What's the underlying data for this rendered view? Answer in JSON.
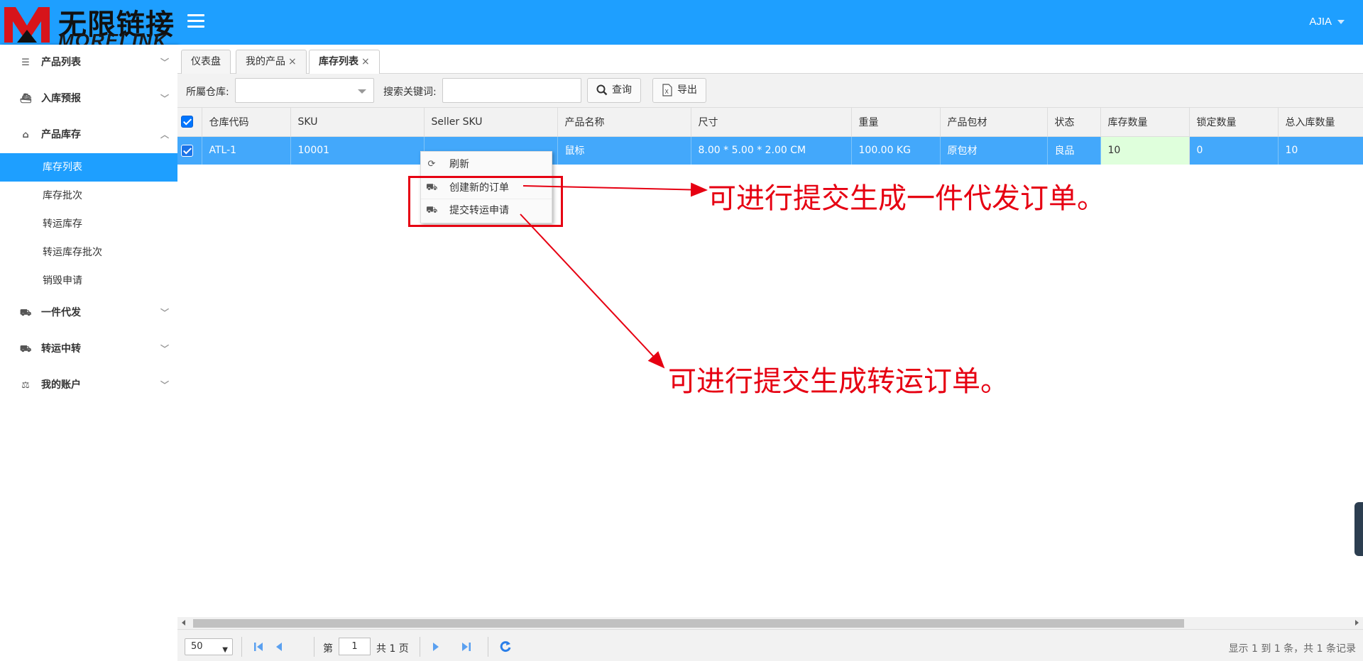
{
  "brand": {
    "cn": "无限链接",
    "en": "MORELINK"
  },
  "header": {
    "user": "AJIA"
  },
  "sidebar": {
    "groups": [
      {
        "label": "产品列表",
        "icon": "list-icon",
        "chevron": "﹀"
      },
      {
        "label": "入库预报",
        "icon": "ship-icon",
        "chevron": "﹀"
      },
      {
        "label": "产品库存",
        "icon": "inbox-icon",
        "chevron": "︿"
      },
      {
        "label": "一件代发",
        "icon": "truck-icon",
        "chevron": "﹀"
      },
      {
        "label": "转运中转",
        "icon": "truck-icon",
        "chevron": "﹀"
      },
      {
        "label": "我的账户",
        "icon": "scale-icon",
        "chevron": "﹀"
      }
    ],
    "sub_items": [
      "库存列表",
      "库存批次",
      "转运库存",
      "转运库存批次",
      "销毁申请"
    ]
  },
  "tabs": [
    {
      "label": "仪表盘"
    },
    {
      "label": "我的产品",
      "close": "×"
    },
    {
      "label": "库存列表",
      "close": "×"
    }
  ],
  "toolbar": {
    "warehouse_label": "所屬仓库:",
    "warehouse_value": "",
    "keyword_label": "搜索关键词:",
    "keyword_value": "",
    "query_button": "查询",
    "export_button": "导出"
  },
  "table": {
    "columns": [
      "仓库代码",
      "SKU",
      "Seller SKU",
      "产品名称",
      "尺寸",
      "重量",
      "产品包材",
      "状态",
      "库存数量",
      "锁定数量",
      "总入库数量"
    ],
    "rows": [
      [
        "ATL-1",
        "10001",
        "",
        "鼠标",
        "8.00 * 5.00 * 2.00 CM",
        "100.00 KG",
        "原包材",
        "良品",
        "10",
        "0",
        "10"
      ]
    ]
  },
  "context_menu": {
    "items": [
      {
        "label": "刷新",
        "icon": "refresh-icon"
      },
      {
        "label": "创建新的订单",
        "icon": "truck-icon"
      },
      {
        "label": "提交转运申请",
        "icon": "truck-icon"
      }
    ]
  },
  "annotations": {
    "a1": "可进行提交生成一件代发订单。",
    "a2": "可进行提交生成转运订单。",
    "color": "#e60012"
  },
  "pager": {
    "page_size": "50",
    "page_prefix": "第",
    "current_page": "1",
    "page_suffix": "共 1 页",
    "info": "显示 1 到 1 条，共 1 条记录"
  },
  "colors": {
    "accent": "#1e9fff",
    "selected_row": "#43a8fb",
    "stock_cell": "#dfffdc"
  }
}
